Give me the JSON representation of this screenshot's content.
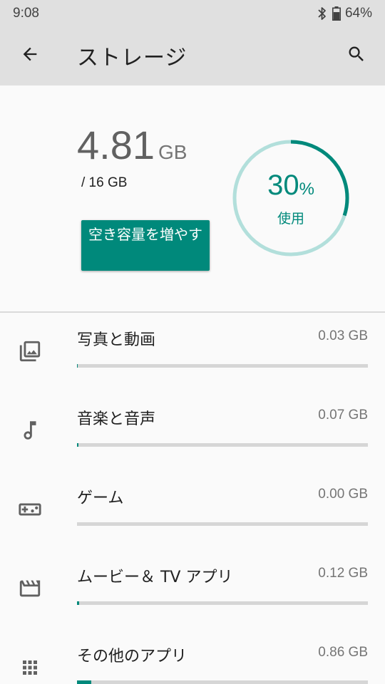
{
  "status_bar": {
    "time": "9:08",
    "battery": "64%",
    "bluetooth_icon": "bluetooth-icon",
    "battery_icon": "battery-icon"
  },
  "app_bar": {
    "title": "ストレージ",
    "back_icon": "arrow-back-icon",
    "search_icon": "search-icon"
  },
  "summary": {
    "used_value": "4.81",
    "used_unit": "GB",
    "total": "/ 16 GB",
    "free_up_button": "空き容量を増やす",
    "percent_value": "30",
    "percent_sign": "%",
    "percent_label": "使用",
    "percent_used_fraction": 0.3
  },
  "categories": [
    {
      "label": "写真と動画",
      "size": "0.03 GB",
      "icon": "photo-library-icon",
      "fraction": 0.002
    },
    {
      "label": "音楽と音声",
      "size": "0.07 GB",
      "icon": "music-note-icon",
      "fraction": 0.004
    },
    {
      "label": "ゲーム",
      "size": "0.00 GB",
      "icon": "gamepad-icon",
      "fraction": 0.0
    },
    {
      "label": "ムービー＆ TV アプリ",
      "size": "0.12 GB",
      "icon": "movie-icon",
      "fraction": 0.007
    },
    {
      "label": "その他のアプリ",
      "size": "0.86 GB",
      "icon": "apps-icon",
      "fraction": 0.05
    }
  ],
  "colors": {
    "accent": "#00897b",
    "gauge_track": "#b2dfdb",
    "bar_track": "#d6d6d6",
    "app_bar": "#e0e0e0"
  }
}
